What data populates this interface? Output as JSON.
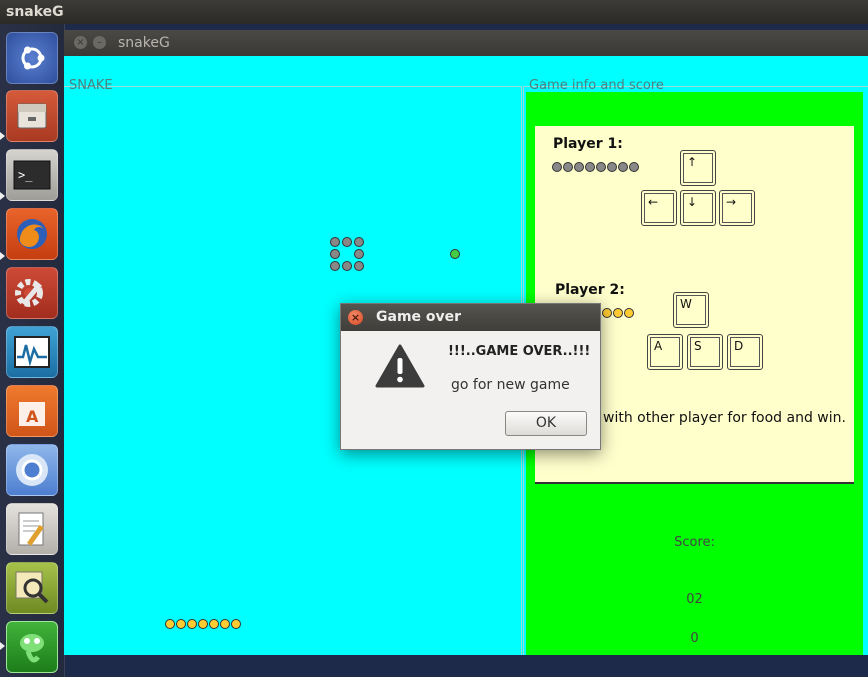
{
  "top_panel": {
    "app_name": "snakeG"
  },
  "launcher": {
    "items": [
      {
        "icon": "ubuntu-dash-icon"
      },
      {
        "icon": "files-icon"
      },
      {
        "icon": "terminal-icon"
      },
      {
        "icon": "firefox-icon"
      },
      {
        "icon": "system-settings-icon"
      },
      {
        "icon": "system-monitor-icon"
      },
      {
        "icon": "software-center-icon"
      },
      {
        "icon": "chromium-icon"
      },
      {
        "icon": "text-editor-icon"
      },
      {
        "icon": "image-viewer-icon"
      },
      {
        "icon": "snakeg-app-icon"
      }
    ]
  },
  "window": {
    "title": "snakeG",
    "snake_panel_title": "SNAKE",
    "info_panel_title": "Game info and score"
  },
  "info": {
    "player1_label": "Player 1:",
    "player1_keys": [
      "↑",
      "←",
      "↓",
      "→"
    ],
    "player2_label": "Player 2:",
    "player2_keys": [
      "W",
      "A",
      "S",
      "D"
    ],
    "instruction": "Compete with other player for food and win.",
    "score_label": "Score:",
    "score_player1": "02",
    "score_player2": "0"
  },
  "dialog": {
    "title": "Game over",
    "heading": "!!!..GAME OVER..!!!",
    "message": "go for new game",
    "ok_label": "OK"
  },
  "colors": {
    "snake_field": "#00ffff",
    "info_background": "#00ff00",
    "instruction_card": "#ffffcc",
    "player1_snake": "#888888",
    "player2_snake": "#ffcc33",
    "food": "#44cc44"
  }
}
